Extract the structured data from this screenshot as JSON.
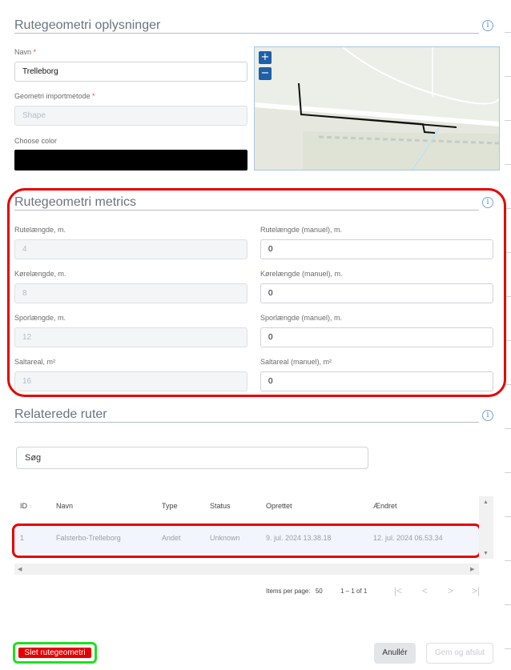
{
  "info_section": {
    "title": "Rutegeometri oplysninger",
    "name_label": "Navn",
    "name_required": "*",
    "name_value": "Trelleborg",
    "import_label": "Geometri importmetode",
    "import_required": "*",
    "import_value": "Shape",
    "color_label": "Choose color",
    "color_value": "#000000",
    "info_icon": "i",
    "map": {
      "zoom_in": "+",
      "zoom_out": "−"
    }
  },
  "metrics_section": {
    "title": "Rutegeometri metrics",
    "info_icon": "i",
    "route_length_label": "Rutelængde, m.",
    "route_length_value": "4",
    "route_length_manual_label": "Rutelængde (manuel), m.",
    "route_length_manual_value": "0",
    "drive_length_label": "Kørelængde, m.",
    "drive_length_value": "8",
    "drive_length_manual_label": "Kørelængde (manuel), m.",
    "drive_length_manual_value": "0",
    "track_length_label": "Sporlængde, m.",
    "track_length_value": "12",
    "track_length_manual_label": "Sporlængde (manuel), m.",
    "track_length_manual_value": "0",
    "salt_area_label": "Saltareal, m²",
    "salt_area_value": "16",
    "salt_area_manual_label": "Saltareal (manuel), m²",
    "salt_area_manual_value": "0"
  },
  "related_section": {
    "title": "Relaterede ruter",
    "info_icon": "i",
    "search_placeholder": "Søg",
    "columns": [
      "ID",
      "Navn",
      "Type",
      "Status",
      "Oprettet",
      "Ændret"
    ],
    "sort_indicator": "↑",
    "rows": [
      {
        "id": "1",
        "name": "Falsterbo-Trelleborg",
        "type": "Andet",
        "status": "Unknown",
        "created": "9. jul. 2024 13.38.18",
        "changed": "12. jul. 2024 06.53.34"
      }
    ],
    "pager": {
      "items_per_page_label": "Items per page:",
      "items_per_page_value": "50",
      "range": "1 – 1 of 1",
      "first": "|<",
      "prev": "<",
      "next": ">",
      "last": ">|"
    }
  },
  "footer": {
    "delete_label": "Slet rutegeometri",
    "cancel_label": "Anullér",
    "save_label": "Gem og afslut"
  },
  "colors": {
    "highlight": "#e60000",
    "delete_outline": "#1fe01f",
    "accent": "#1f5fa8"
  }
}
